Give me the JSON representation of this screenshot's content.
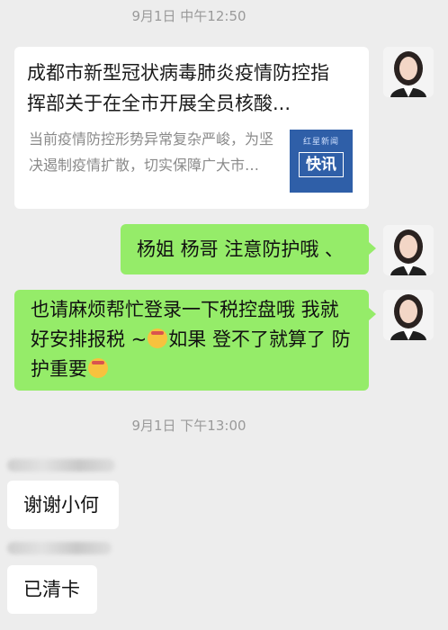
{
  "timestamps": [
    "9月1日 中午12:50",
    "9月1日 下午13:00"
  ],
  "card": {
    "title": "成都市新型冠状病毒肺炎疫情防控指挥部关于在全市开展全员核酸...",
    "description": "当前疫情防控形势异常复杂严峻，为坚决遏制疫情扩散，切实保障广大市民群众身体健康，...",
    "thumb_small": "红星新闻",
    "thumb_big": "快讯"
  },
  "messages": {
    "m1": "杨姐 杨哥  注意防护哦 、",
    "m2_part1": "也请麻烦帮忙登录一下税控盘哦  我就好安排报税 ~",
    "m2_part2": "如果  登不了就算了  防护重要",
    "m3": "谢谢小何",
    "m4": "已清卡"
  },
  "icons": {
    "avatar": "avatar-icon",
    "emoji": "shush-face-emoji-icon"
  },
  "colors": {
    "background": "#ededed",
    "sent_bubble": "#95ec69",
    "received_bubble": "#ffffff",
    "timestamp": "#9a9a9a"
  }
}
